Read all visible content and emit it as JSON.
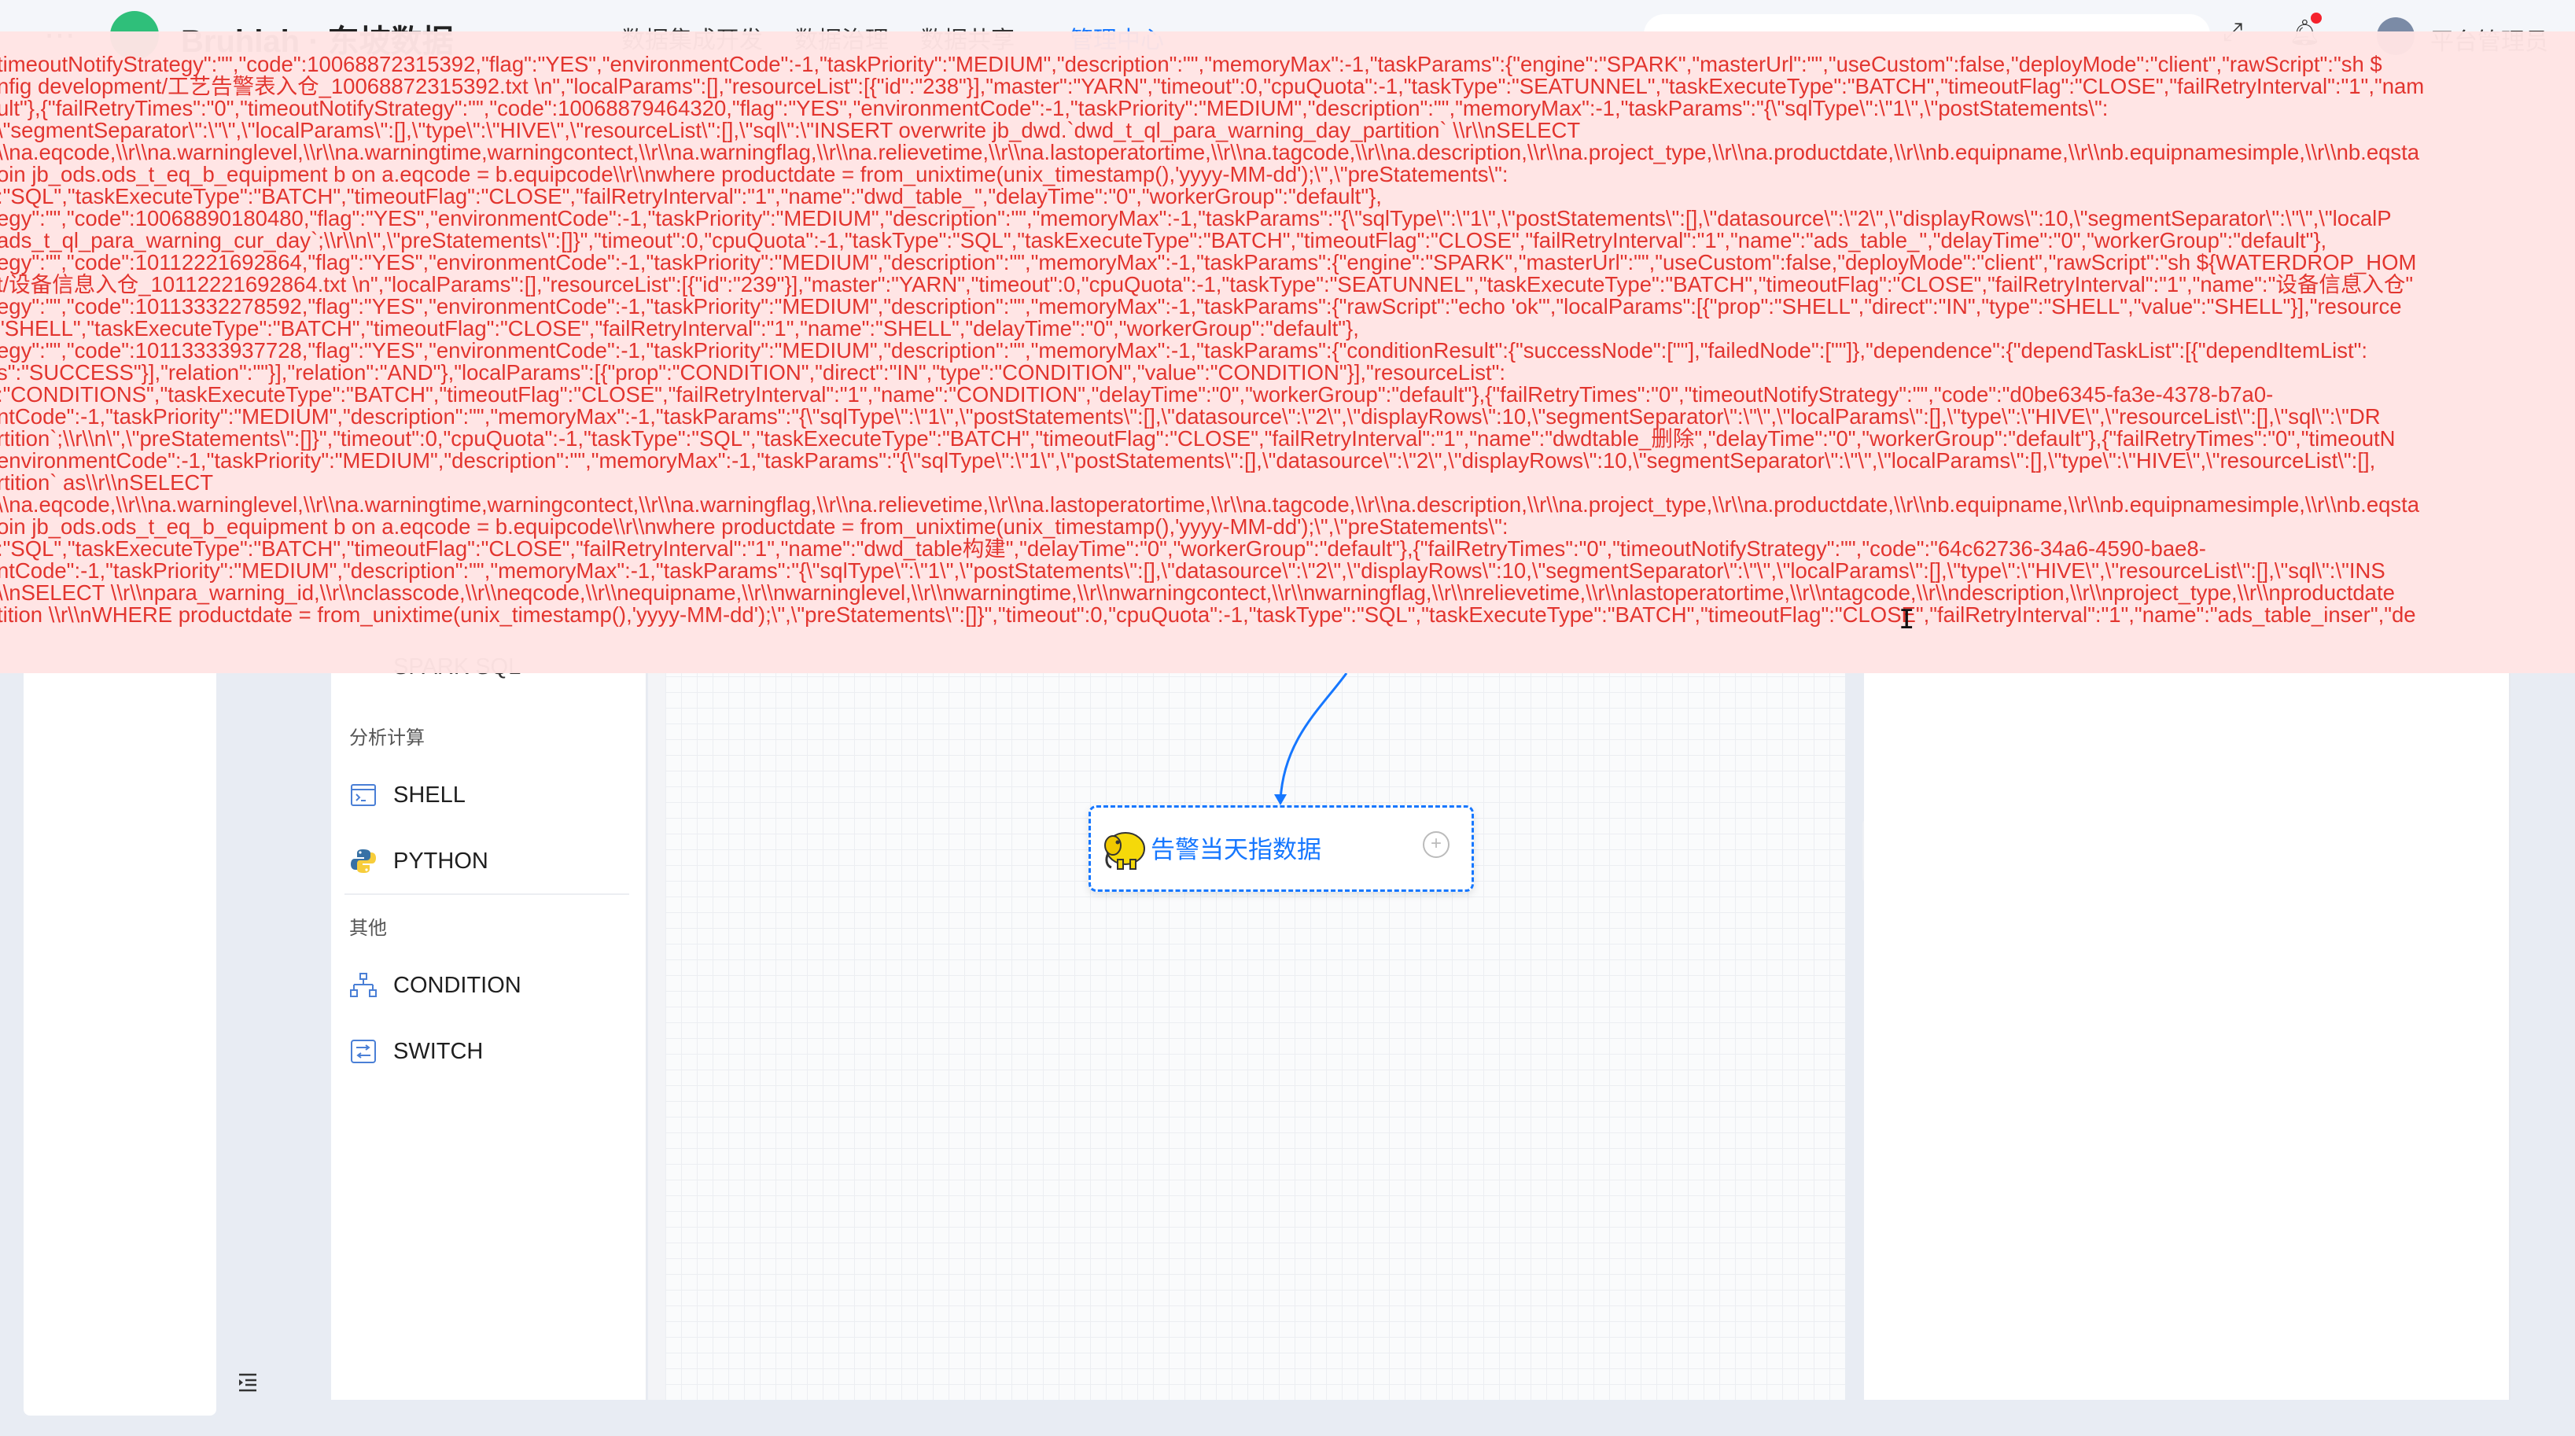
{
  "topbar": {
    "apps_icon": "grid-dots-icon",
    "title": "Bruhlah · 东坡数据",
    "menus": [
      "数据集成开发",
      "数据治理",
      "数据共享",
      "管理中心"
    ],
    "user": "平台管理员"
  },
  "palette": {
    "obscured_item": "SPARK SQL",
    "sections": [
      {
        "title": "分析计算",
        "items": [
          {
            "label": "SHELL",
            "icon": "shell-icon"
          },
          {
            "label": "PYTHON",
            "icon": "python-icon"
          }
        ]
      },
      {
        "title": "其他",
        "items": [
          {
            "label": "CONDITION",
            "icon": "condition-icon"
          },
          {
            "label": "SWITCH",
            "icon": "switch-icon"
          }
        ]
      }
    ]
  },
  "canvas": {
    "node": {
      "label": "告警当天指数据",
      "icon": "hadoop-elephant-icon"
    }
  },
  "right_panel": {
    "expand_icon": "double-chevron-right-icon"
  },
  "left_nav": {
    "collapse_icon": "menu-fold-icon"
  },
  "colors": {
    "accent": "#1677ff",
    "error_text": "#e2352f",
    "error_bg": "#ffe4e4"
  },
  "error_banner": {
    "lines": [
      "timeoutNotifyStrategy\":\"\",\"code\":10068872315392,\"flag\":\"YES\",\"environmentCode\":-1,\"taskPriority\":\"MEDIUM\",\"description\":\"\",\"memoryMax\":-1,\"taskParams\":{\"engine\":\"SPARK\",\"masterUrl\":\"\",\"useCustom\":false,\"deployMode\":\"client\",\"rawScript\":\"sh $",
      "nfig development/工艺告警表入仓_10068872315392.txt \\n\",\"localParams\":[],\"resourceList\":[{\"id\":\"238\"}],\"master\":\"YARN\",\"timeout\":0,\"cpuQuota\":-1,\"taskType\":\"SEATUNNEL\",\"taskExecuteType\":\"BATCH\",\"timeoutFlag\":\"CLOSE\",\"failRetryInterval\":\"1\",\"nam",
      "ult\"},{\"failRetryTimes\":\"0\",\"timeoutNotifyStrategy\":\"\",\"code\":10068879464320,\"flag\":\"YES\",\"environmentCode\":-1,\"taskPriority\":\"MEDIUM\",\"description\":\"\",\"memoryMax\":-1,\"taskParams\":\"{\\\"sqlType\\\":\\\"1\\\",\\\"postStatements\\\":",
      "\\\"segmentSeparator\\\":\\\"\\\",\\\"localParams\\\":[],\\\"type\\\":\\\"HIVE\\\",\\\"resourceList\\\":[],\\\"sql\\\":\\\"INSERT overwrite jb_dwd.`dwd_t_ql_para_warning_day_partition` \\\\r\\\\nSELECT",
      "\\\\na.eqcode,\\\\r\\\\na.warninglevel,\\\\r\\\\na.warningtime,warningcontect,\\\\r\\\\na.warningflag,\\\\r\\\\na.relievetime,\\\\r\\\\na.lastoperatortime,\\\\r\\\\na.tagcode,\\\\r\\\\na.description,\\\\r\\\\na.project_type,\\\\r\\\\na.productdate,\\\\r\\\\nb.equipname,\\\\r\\\\nb.equipnamesimple,\\\\r\\\\nb.eqsta",
      "oin jb_ods.ods_t_eq_b_equipment b on a.eqcode = b.equipcode\\\\r\\\\nwhere productdate = from_unixtime(unix_timestamp(),'yyyy-MM-dd');\\\",\\\"preStatements\\\":",
      ":\"SQL\",\"taskExecuteType\":\"BATCH\",\"timeoutFlag\":\"CLOSE\",\"failRetryInterval\":\"1\",\"name\":\"dwd_table_\",\"delayTime\":\"0\",\"workerGroup\":\"default\"},",
      "egy\":\"\",\"code\":10068890180480,\"flag\":\"YES\",\"environmentCode\":-1,\"taskPriority\":\"MEDIUM\",\"description\":\"\",\"memoryMax\":-1,\"taskParams\":\"{\\\"sqlType\\\":\\\"1\\\",\\\"postStatements\\\":[],\\\"datasource\\\":\\\"2\\\",\\\"displayRows\\\":10,\\\"segmentSeparator\\\":\\\"\\\",\\\"localP",
      "ads_t_ql_para_warning_cur_day`;\\\\r\\\\n\\\",\\\"preStatements\\\":[]}\",\"timeout\":0,\"cpuQuota\":-1,\"taskType\":\"SQL\",\"taskExecuteType\":\"BATCH\",\"timeoutFlag\":\"CLOSE\",\"failRetryInterval\":\"1\",\"name\":\"ads_table_\",\"delayTime\":\"0\",\"workerGroup\":\"default\"},",
      "egy\":\"\",\"code\":10112221692864,\"flag\":\"YES\",\"environmentCode\":-1,\"taskPriority\":\"MEDIUM\",\"description\":\"\",\"memoryMax\":-1,\"taskParams\":{\"engine\":\"SPARK\",\"masterUrl\":\"\",\"useCustom\":false,\"deployMode\":\"client\",\"rawScript\":\"sh ${WATERDROP_HOM",
      "t/设备信息入仓_10112221692864.txt \\n\",\"localParams\":[],\"resourceList\":[{\"id\":\"239\"}],\"master\":\"YARN\",\"timeout\":0,\"cpuQuota\":-1,\"taskType\":\"SEATUNNEL\",\"taskExecuteType\":\"BATCH\",\"timeoutFlag\":\"CLOSE\",\"failRetryInterval\":\"1\",\"name\":\"设备信息入仓\"",
      "egy\":\"\",\"code\":10113332278592,\"flag\":\"YES\",\"environmentCode\":-1,\"taskPriority\":\"MEDIUM\",\"description\":\"\",\"memoryMax\":-1,\"taskParams\":{\"rawScript\":\"echo 'ok'\",\"localParams\":[{\"prop\":\"SHELL\",\"direct\":\"IN\",\"type\":\"SHELL\",\"value\":\"SHELL\"}],\"resource",
      "\"SHELL\",\"taskExecuteType\":\"BATCH\",\"timeoutFlag\":\"CLOSE\",\"failRetryInterval\":\"1\",\"name\":\"SHELL\",\"delayTime\":\"0\",\"workerGroup\":\"default\"},",
      "egy\":\"\",\"code\":10113333937728,\"flag\":\"YES\",\"environmentCode\":-1,\"taskPriority\":\"MEDIUM\",\"description\":\"\",\"memoryMax\":-1,\"taskParams\":{\"conditionResult\":{\"successNode\":[\"\"],\"failedNode\":[\"\"]},\"dependence\":{\"dependTaskList\":[{\"dependItemList\":",
      "s\":\"SUCCESS\"}],\"relation\":\"\"}],\"relation\":\"AND\"},\"localParams\":[{\"prop\":\"CONDITION\",\"direct\":\"IN\",\"type\":\"CONDITION\",\"value\":\"CONDITION\"}],\"resourceList\":",
      ":\"CONDITIONS\",\"taskExecuteType\":\"BATCH\",\"timeoutFlag\":\"CLOSE\",\"failRetryInterval\":\"1\",\"name\":\"CONDITION\",\"delayTime\":\"0\",\"workerGroup\":\"default\"},{\"failRetryTimes\":\"0\",\"timeoutNotifyStrategy\":\"\",\"code\":\"d0be6345-fa3e-4378-b7a0-",
      "ntCode\":-1,\"taskPriority\":\"MEDIUM\",\"description\":\"\",\"memoryMax\":-1,\"taskParams\":\"{\\\"sqlType\\\":\\\"1\\\",\\\"postStatements\\\":[],\\\"datasource\\\":\\\"2\\\",\\\"displayRows\\\":10,\\\"segmentSeparator\\\":\\\"\\\",\\\"localParams\\\":[],\\\"type\\\":\\\"HIVE\\\",\\\"resourceList\\\":[],\\\"sql\\\":\\\"DR",
      "rtition`;\\\\r\\\\n\\\",\\\"preStatements\\\":[]}\",\"timeout\":0,\"cpuQuota\":-1,\"taskType\":\"SQL\",\"taskExecuteType\":\"BATCH\",\"timeoutFlag\":\"CLOSE\",\"failRetryInterval\":\"1\",\"name\":\"dwdtable_删除\",\"delayTime\":\"0\",\"workerGroup\":\"default\"},{\"failRetryTimes\":\"0\",\"timeoutN",
      "environmentCode\":-1,\"taskPriority\":\"MEDIUM\",\"description\":\"\",\"memoryMax\":-1,\"taskParams\":\"{\\\"sqlType\\\":\\\"1\\\",\\\"postStatements\\\":[],\\\"datasource\\\":\\\"2\\\",\\\"displayRows\\\":10,\\\"segmentSeparator\\\":\\\"\\\",\\\"localParams\\\":[],\\\"type\\\":\\\"HIVE\\\",\\\"resourceList\\\":[],",
      "rtition` as\\\\r\\\\nSELECT",
      "\\\\na.eqcode,\\\\r\\\\na.warninglevel,\\\\r\\\\na.warningtime,warningcontect,\\\\r\\\\na.warningflag,\\\\r\\\\na.relievetime,\\\\r\\\\na.lastoperatortime,\\\\r\\\\na.tagcode,\\\\r\\\\na.description,\\\\r\\\\na.project_type,\\\\r\\\\na.productdate,\\\\r\\\\nb.equipname,\\\\r\\\\nb.equipnamesimple,\\\\r\\\\nb.eqsta",
      "oin jb_ods.ods_t_eq_b_equipment b on a.eqcode = b.equipcode\\\\r\\\\nwhere productdate = from_unixtime(unix_timestamp(),'yyyy-MM-dd');\\\",\\\"preStatements\\\":",
      ":\"SQL\",\"taskExecuteType\":\"BATCH\",\"timeoutFlag\":\"CLOSE\",\"failRetryInterval\":\"1\",\"name\":\"dwd_table构建\",\"delayTime\":\"0\",\"workerGroup\":\"default\"},{\"failRetryTimes\":\"0\",\"timeoutNotifyStrategy\":\"\",\"code\":\"64c62736-34a6-4590-bae8-",
      "ntCode\":-1,\"taskPriority\":\"MEDIUM\",\"description\":\"\",\"memoryMax\":-1,\"taskParams\":\"{\\\"sqlType\\\":\\\"1\\\",\\\"postStatements\\\":[],\\\"datasource\\\":\\\"2\\\",\\\"displayRows\\\":10,\\\"segmentSeparator\\\":\\\"\\\",\\\"localParams\\\":[],\\\"type\\\":\\\"HIVE\\\",\\\"resourceList\\\":[],\\\"sql\\\":\\\"INS",
      "\\\\nSELECT \\\\r\\\\npara_warning_id,\\\\r\\\\nclasscode,\\\\r\\\\neqcode,\\\\r\\\\nequipname,\\\\r\\\\nwarninglevel,\\\\r\\\\nwarningtime,\\\\r\\\\nwarningcontect,\\\\r\\\\nwarningflag,\\\\r\\\\nrelievetime,\\\\r\\\\nlastoperatortime,\\\\r\\\\ntagcode,\\\\r\\\\ndescription,\\\\r\\\\nproject_type,\\\\r\\\\nproductdate",
      "tition \\\\r\\\\nWHERE productdate = from_unixtime(unix_timestamp(),'yyyy-MM-dd');\\\",\\\"preStatements\\\":[]}\",\"timeout\":0,\"cpuQuota\":-1,\"taskType\":\"SQL\",\"taskExecuteType\":\"BATCH\",\"timeoutFlag\":\"CLOSE\",\"failRetryInterval\":\"1\",\"name\":\"ads_table_inser\",\"de"
    ]
  }
}
